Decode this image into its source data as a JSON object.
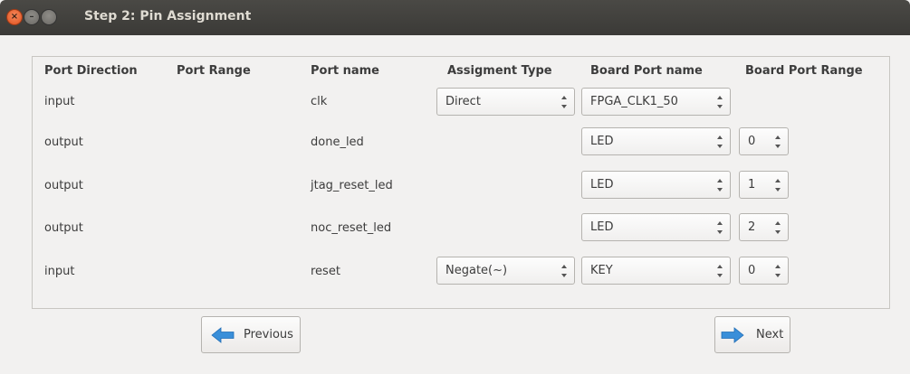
{
  "window": {
    "title": "Step 2: Pin Assignment"
  },
  "headers": {
    "port_direction": "Port Direction",
    "port_range": "Port Range",
    "port_name": "Port name",
    "assignment_type": "Assigment Type",
    "board_port_name": "Board Port name",
    "board_port_range": "Board Port Range"
  },
  "rows": [
    {
      "direction": "input",
      "name": "clk",
      "assignment_type": "Direct",
      "board_port": "FPGA_CLK1_50",
      "board_range": ""
    },
    {
      "direction": "output",
      "name": "done_led",
      "assignment_type": "",
      "board_port": "LED",
      "board_range": "0"
    },
    {
      "direction": "output",
      "name": "jtag_reset_led",
      "assignment_type": "",
      "board_port": "LED",
      "board_range": "1"
    },
    {
      "direction": "output",
      "name": "noc_reset_led",
      "assignment_type": "",
      "board_port": "LED",
      "board_range": "2"
    },
    {
      "direction": "input",
      "name": "reset",
      "assignment_type": "Negate(~)",
      "board_port": "KEY",
      "board_range": "0"
    }
  ],
  "buttons": {
    "previous": "Previous",
    "next": "Next"
  },
  "icons": {
    "previous": "arrow-left-icon",
    "next": "arrow-right-icon"
  },
  "colors": {
    "titlebar": "#3c3b37",
    "close_button": "#e95420",
    "arrow_icon": "#3a8fd9"
  }
}
